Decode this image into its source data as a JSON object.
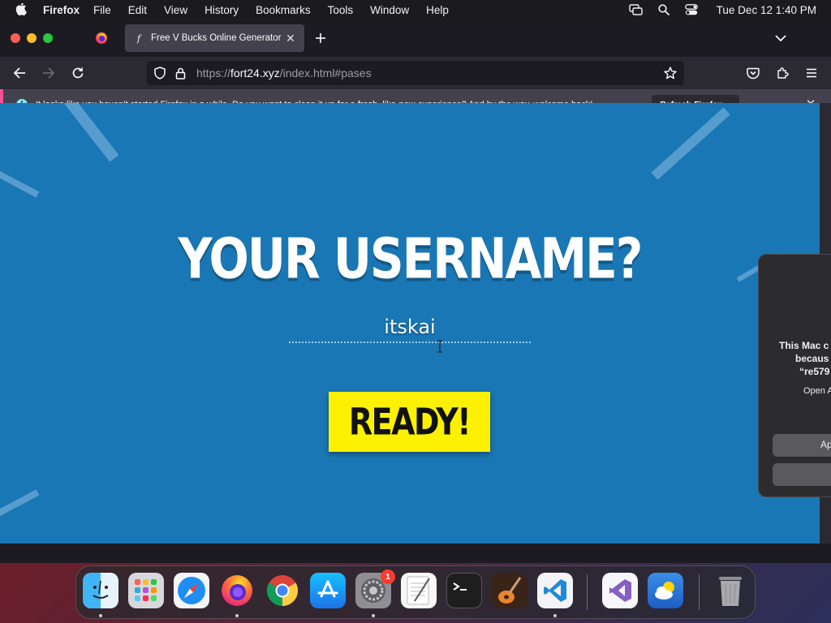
{
  "menubar": {
    "app_name": "Firefox",
    "menus": [
      "File",
      "Edit",
      "View",
      "History",
      "Bookmarks",
      "Tools",
      "Window",
      "Help"
    ],
    "clock": "Tue Dec 12  1:40 PM",
    "status_icons": [
      "screen-mirroring-icon",
      "spotlight-search-icon",
      "control-center-icon"
    ]
  },
  "browser": {
    "tab": {
      "title": "Free V Bucks Online Generator",
      "favicon": "f"
    },
    "url": {
      "scheme": "https://",
      "host": "fort24.xyz",
      "path": "/index.html#pases"
    },
    "notification": {
      "message": "It looks like you haven’t started Firefox in a while. Do you want to clean it up for a fresh, like-new experience? And by the way, welcome back!",
      "button": "Refresh Firefox…",
      "info_glyph": "i"
    }
  },
  "page": {
    "headline": "YOUR USERNAME?",
    "username_value": "itskai",
    "ready_label": "READY!"
  },
  "dialog": {
    "line1": "This Mac c",
    "line2": "becaus",
    "line3": "“re579",
    "line4": "Open A",
    "button1": "Ap"
  },
  "dock": {
    "apps": [
      "Finder",
      "Launchpad",
      "Safari",
      "Firefox",
      "Google Chrome",
      "App Store",
      "System Settings",
      "TextEdit",
      "Terminal",
      "GarageBand",
      "Visual Studio Code",
      "Visual Studio",
      "Weather",
      "Trash"
    ],
    "settings_badge": "1"
  },
  "colors": {
    "page_background": "#1a77b5",
    "ready_button": "#fbf100",
    "notification_accent": "#ff4f9a"
  }
}
